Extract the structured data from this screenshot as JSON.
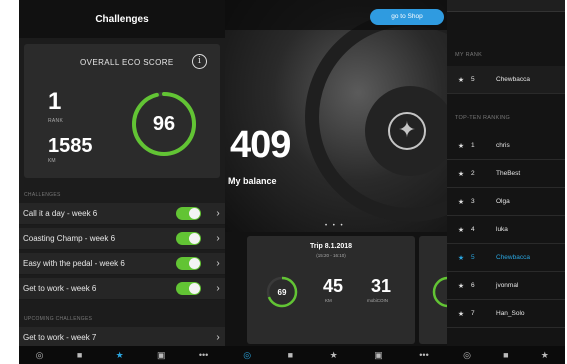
{
  "challenges_panel": {
    "title": "Challenges",
    "eco_score_title": "OVERALL ECO SCORE",
    "info_icon": "i",
    "rank_value": "1",
    "rank_label": "RANK",
    "km_value": "1585",
    "km_label": "KM",
    "score_value": "96",
    "score_fraction": 0.96,
    "challenges_section": "CHALLENGES",
    "challenges": [
      {
        "label": "Call it a day - week 6",
        "enabled": true
      },
      {
        "label": "Coasting Champ - week 6",
        "enabled": true
      },
      {
        "label": "Easy with the pedal - week 6",
        "enabled": true
      },
      {
        "label": "Get to work - week 6",
        "enabled": true
      }
    ],
    "upcoming_section": "UPCOMING CHALLENGES",
    "upcoming": [
      {
        "label": "Get to work - week 7"
      }
    ]
  },
  "balance_panel": {
    "shop_button": "go to Shop",
    "balance_value": "409",
    "balance_label": "My balance",
    "pager_dots": "• • •",
    "trip": {
      "title": "Trip 8.1.2018",
      "time": "(15:20 - 16:10)",
      "score": "69",
      "score_fraction": 0.69,
      "km_value": "45",
      "km_label": "KM",
      "coin_value": "31",
      "coin_label": "mobiCOIN"
    }
  },
  "ranking_panel": {
    "my_rank_section": "MY RANK",
    "my_rank": {
      "position": "5",
      "name": "Chewbacca"
    },
    "top_ten_section": "TOP-TEN RANKING",
    "top_ten": [
      {
        "position": "1",
        "name": "chris",
        "me": false
      },
      {
        "position": "2",
        "name": "TheBest",
        "me": false
      },
      {
        "position": "3",
        "name": "Olga",
        "me": false
      },
      {
        "position": "4",
        "name": "luka",
        "me": false
      },
      {
        "position": "5",
        "name": "Chewbacca",
        "me": true
      },
      {
        "position": "6",
        "name": "jvonmal",
        "me": false
      },
      {
        "position": "7",
        "name": "Han_Solo",
        "me": false
      }
    ]
  },
  "bottom_nav": {
    "items": [
      {
        "icon": "steering-wheel-icon",
        "glyph": "◎"
      },
      {
        "icon": "tablet-icon",
        "glyph": "■"
      },
      {
        "icon": "trophy-icon",
        "glyph": "★"
      },
      {
        "icon": "car-icon",
        "glyph": "▣"
      },
      {
        "icon": "more-icon",
        "glyph": "•••"
      }
    ]
  },
  "colors": {
    "accent_green": "#62c434",
    "accent_blue": "#2aa5df",
    "panel_bg": "#1c1c1c"
  }
}
